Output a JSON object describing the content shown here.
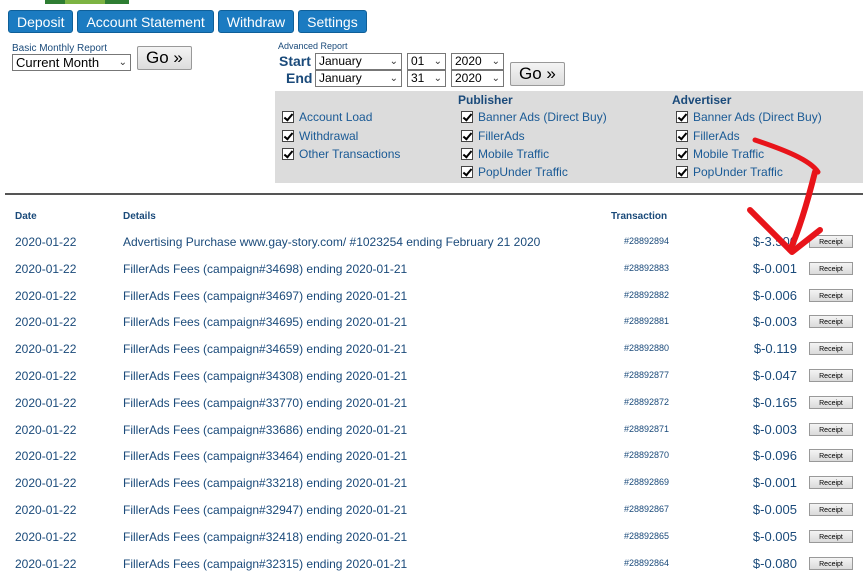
{
  "nav": [
    "Deposit",
    "Account Statement",
    "Withdraw",
    "Settings"
  ],
  "basic": {
    "label": "Basic Monthly Report",
    "selected": "Current Month",
    "go": "Go »"
  },
  "advanced": {
    "label": "Advanced Report",
    "start_label": "Start",
    "end_label": "End",
    "start": {
      "month": "January",
      "day": "01",
      "year": "2020"
    },
    "end": {
      "month": "January",
      "day": "31",
      "year": "2020"
    },
    "go": "Go »"
  },
  "filters": {
    "general": [
      "Account Load",
      "Withdrawal",
      "Other Transactions"
    ],
    "publisher_head": "Publisher",
    "publisher": [
      "Banner Ads (Direct Buy)",
      "FillerAds",
      "Mobile Traffic",
      "PopUnder Traffic"
    ],
    "advertiser_head": "Advertiser",
    "advertiser": [
      "Banner Ads (Direct Buy)",
      "FillerAds",
      "Mobile Traffic",
      "PopUnder Traffic"
    ]
  },
  "table": {
    "headers": {
      "date": "Date",
      "details": "Details",
      "transaction": "Transaction"
    },
    "receipt_label": "Receipt",
    "rows": [
      {
        "date": "2020-01-22",
        "details": "Advertising Purchase www.gay-story.com/ #1023254 ending February 21 2020",
        "tx": "#28892894",
        "amount": "$-3.500"
      },
      {
        "date": "2020-01-22",
        "details": "FillerAds Fees (campaign#34698) ending 2020-01-21",
        "tx": "#28892883",
        "amount": "$-0.001"
      },
      {
        "date": "2020-01-22",
        "details": "FillerAds Fees (campaign#34697) ending 2020-01-21",
        "tx": "#28892882",
        "amount": "$-0.006"
      },
      {
        "date": "2020-01-22",
        "details": "FillerAds Fees (campaign#34695) ending 2020-01-21",
        "tx": "#28892881",
        "amount": "$-0.003"
      },
      {
        "date": "2020-01-22",
        "details": "FillerAds Fees (campaign#34659) ending 2020-01-21",
        "tx": "#28892880",
        "amount": "$-0.119"
      },
      {
        "date": "2020-01-22",
        "details": "FillerAds Fees (campaign#34308) ending 2020-01-21",
        "tx": "#28892877",
        "amount": "$-0.047"
      },
      {
        "date": "2020-01-22",
        "details": "FillerAds Fees (campaign#33770) ending 2020-01-21",
        "tx": "#28892872",
        "amount": "$-0.165"
      },
      {
        "date": "2020-01-22",
        "details": "FillerAds Fees (campaign#33686) ending 2020-01-21",
        "tx": "#28892871",
        "amount": "$-0.003"
      },
      {
        "date": "2020-01-22",
        "details": "FillerAds Fees (campaign#33464) ending 2020-01-21",
        "tx": "#28892870",
        "amount": "$-0.096"
      },
      {
        "date": "2020-01-22",
        "details": "FillerAds Fees (campaign#33218) ending 2020-01-21",
        "tx": "#28892869",
        "amount": "$-0.001"
      },
      {
        "date": "2020-01-22",
        "details": "FillerAds Fees (campaign#32947) ending 2020-01-21",
        "tx": "#28892867",
        "amount": "$-0.005"
      },
      {
        "date": "2020-01-22",
        "details": "FillerAds Fees (campaign#32418) ending 2020-01-21",
        "tx": "#28892865",
        "amount": "$-0.005"
      },
      {
        "date": "2020-01-22",
        "details": "FillerAds Fees (campaign#32315) ending 2020-01-21",
        "tx": "#28892864",
        "amount": "$-0.080"
      }
    ]
  },
  "annotation": {
    "arrow_color": "#e8141a",
    "icon": "red-arrow-icon"
  }
}
